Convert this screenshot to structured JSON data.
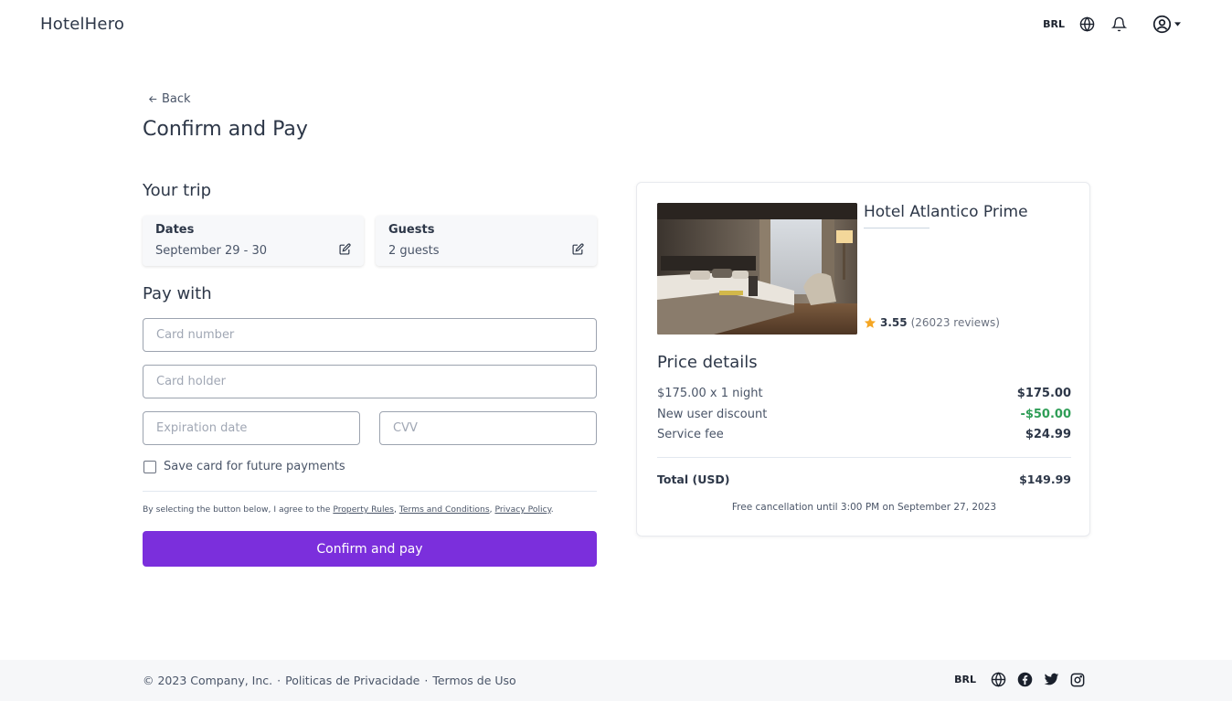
{
  "header": {
    "logo": "HotelHero",
    "currency": "BRL",
    "icons": [
      "globe-icon",
      "bell-icon",
      "user-circle-icon",
      "caret-down-icon"
    ]
  },
  "nav": {
    "back_label": "Back"
  },
  "page": {
    "title": "Confirm and Pay"
  },
  "trip": {
    "title": "Your trip",
    "dates": {
      "label": "Dates",
      "value": "September 29 - 30"
    },
    "guests": {
      "label": "Guests",
      "value": "2 guests"
    }
  },
  "payment": {
    "title": "Pay with",
    "card_number_placeholder": "Card number",
    "card_holder_placeholder": "Card holder",
    "expiration_placeholder": "Expiration date",
    "cvv_placeholder": "CVV",
    "save_card_label": "Save card for future payments",
    "agree_prefix": "By selecting the button below, I agree to the ",
    "property_rules": "Property Rules",
    "sep1": ", ",
    "terms": "Terms and Conditions",
    "sep2": ", ",
    "privacy": "Privacy Policy",
    "agree_suffix": ".",
    "confirm_label": "Confirm and pay"
  },
  "hotel": {
    "name": "Hotel Atlantico Prime",
    "rating": "3.55",
    "reviews": "(26023 reviews)"
  },
  "price": {
    "title": "Price details",
    "rows": [
      {
        "label": "$175.00 x 1 night",
        "amount": "$175.00"
      },
      {
        "label": "New user discount",
        "amount": "-$50.00"
      },
      {
        "label": "Service fee",
        "amount": "$24.99"
      }
    ],
    "total_label": "Total (USD)",
    "total_amount": "$149.99",
    "cancellation_note": "Free cancellation until 3:00 PM on September 27, 2023"
  },
  "footer": {
    "copyright": "© 2023 Company, Inc.",
    "dot1": "·",
    "privacy_link": "Politicas de Privacidade",
    "dot2": "·",
    "terms_link": "Termos de Uso",
    "currency": "BRL"
  },
  "colors": {
    "primary": "#7b2fdc",
    "discount_green": "#2f9e57",
    "star": "#f5a623"
  }
}
